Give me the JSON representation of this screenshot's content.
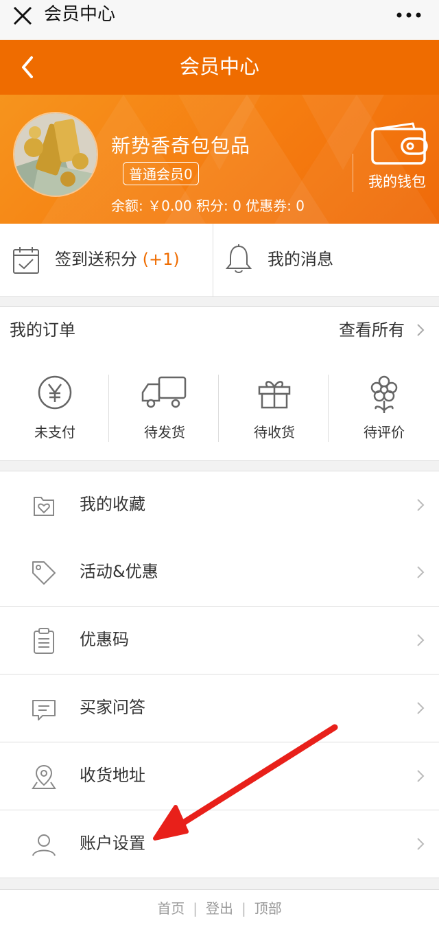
{
  "wechat": {
    "title": "会员中心"
  },
  "nav": {
    "title": "会员中心"
  },
  "profile": {
    "username": "新势香奇包包品",
    "level_badge": "普通会员0",
    "balance_line": "余额: ￥0.00 积分: 0 优惠券: 0",
    "wallet_label": "我的钱包"
  },
  "quick": {
    "checkin_label": "签到送积分",
    "checkin_bonus": "(+1)",
    "messages_label": "我的消息"
  },
  "orders": {
    "title": "我的订单",
    "view_all": "查看所有",
    "items": [
      {
        "label": "未支付",
        "icon": "yen-circle-icon"
      },
      {
        "label": "待发货",
        "icon": "truck-icon"
      },
      {
        "label": "待收货",
        "icon": "gift-box-icon"
      },
      {
        "label": "待评价",
        "icon": "flower-icon"
      }
    ]
  },
  "menu": {
    "items": [
      {
        "label": "我的收藏",
        "icon": "favorite-folder-icon"
      },
      {
        "label": "活动&优惠",
        "icon": "tag-icon"
      },
      {
        "label": "优惠码",
        "icon": "clipboard-icon"
      },
      {
        "label": "买家问答",
        "icon": "chat-icon"
      },
      {
        "label": "收货地址",
        "icon": "location-icon"
      },
      {
        "label": "账户设置",
        "icon": "user-icon"
      }
    ]
  },
  "footer": {
    "home": "首页",
    "logout": "登出",
    "top": "顶部",
    "separator": "|"
  },
  "colors": {
    "accent": "#ef6c00",
    "banner": "#f57c10",
    "background": "#f2f2f2",
    "annotation_arrow": "#e8201a"
  }
}
